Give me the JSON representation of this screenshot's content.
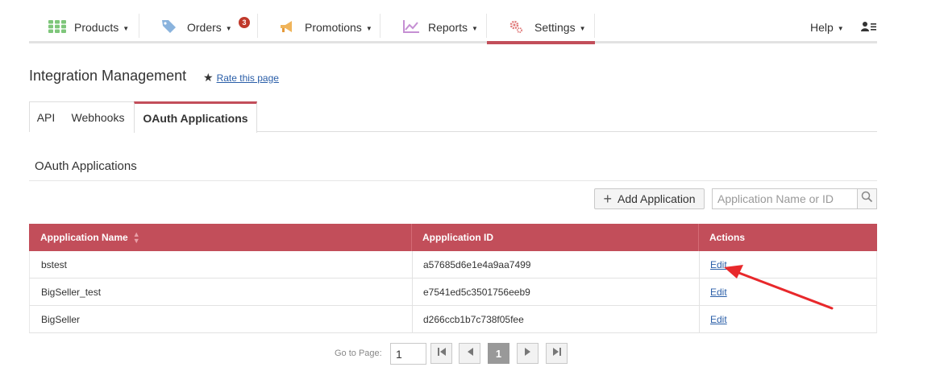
{
  "nav": {
    "items": [
      {
        "label": "Products",
        "icon": "grid-icon"
      },
      {
        "label": "Orders",
        "icon": "tag-icon",
        "badge": "3"
      },
      {
        "label": "Promotions",
        "icon": "megaphone-icon"
      },
      {
        "label": "Reports",
        "icon": "chart-icon"
      },
      {
        "label": "Settings",
        "icon": "gear-icon"
      }
    ],
    "help_label": "Help",
    "active": "Settings"
  },
  "page": {
    "title": "Integration Management",
    "rate_link": "Rate this page"
  },
  "tabs": [
    {
      "label": "API"
    },
    {
      "label": "Webhooks"
    },
    {
      "label": "OAuth Applications",
      "active": true
    }
  ],
  "section": {
    "title": "OAuth Applications",
    "add_button": "Add Application",
    "search_placeholder": "Application Name or ID"
  },
  "table": {
    "headers": [
      "Appplication Name",
      "Appplication ID",
      "Actions"
    ],
    "rows": [
      {
        "name": "bstest",
        "id": "a57685d6e1e4a9aa7499",
        "action": "Edit"
      },
      {
        "name": "BigSeller_test",
        "id": "e7541ed5c3501756eeb9",
        "action": "Edit"
      },
      {
        "name": "BigSeller",
        "id": "d266ccb1b7c738f05fee",
        "action": "Edit"
      }
    ]
  },
  "pager": {
    "label": "Go to Page:",
    "input_value": "1",
    "current_page": "1"
  },
  "colors": {
    "accent": "#c24e5a",
    "link": "#2a5ea8",
    "annotation": "#e8282b"
  }
}
